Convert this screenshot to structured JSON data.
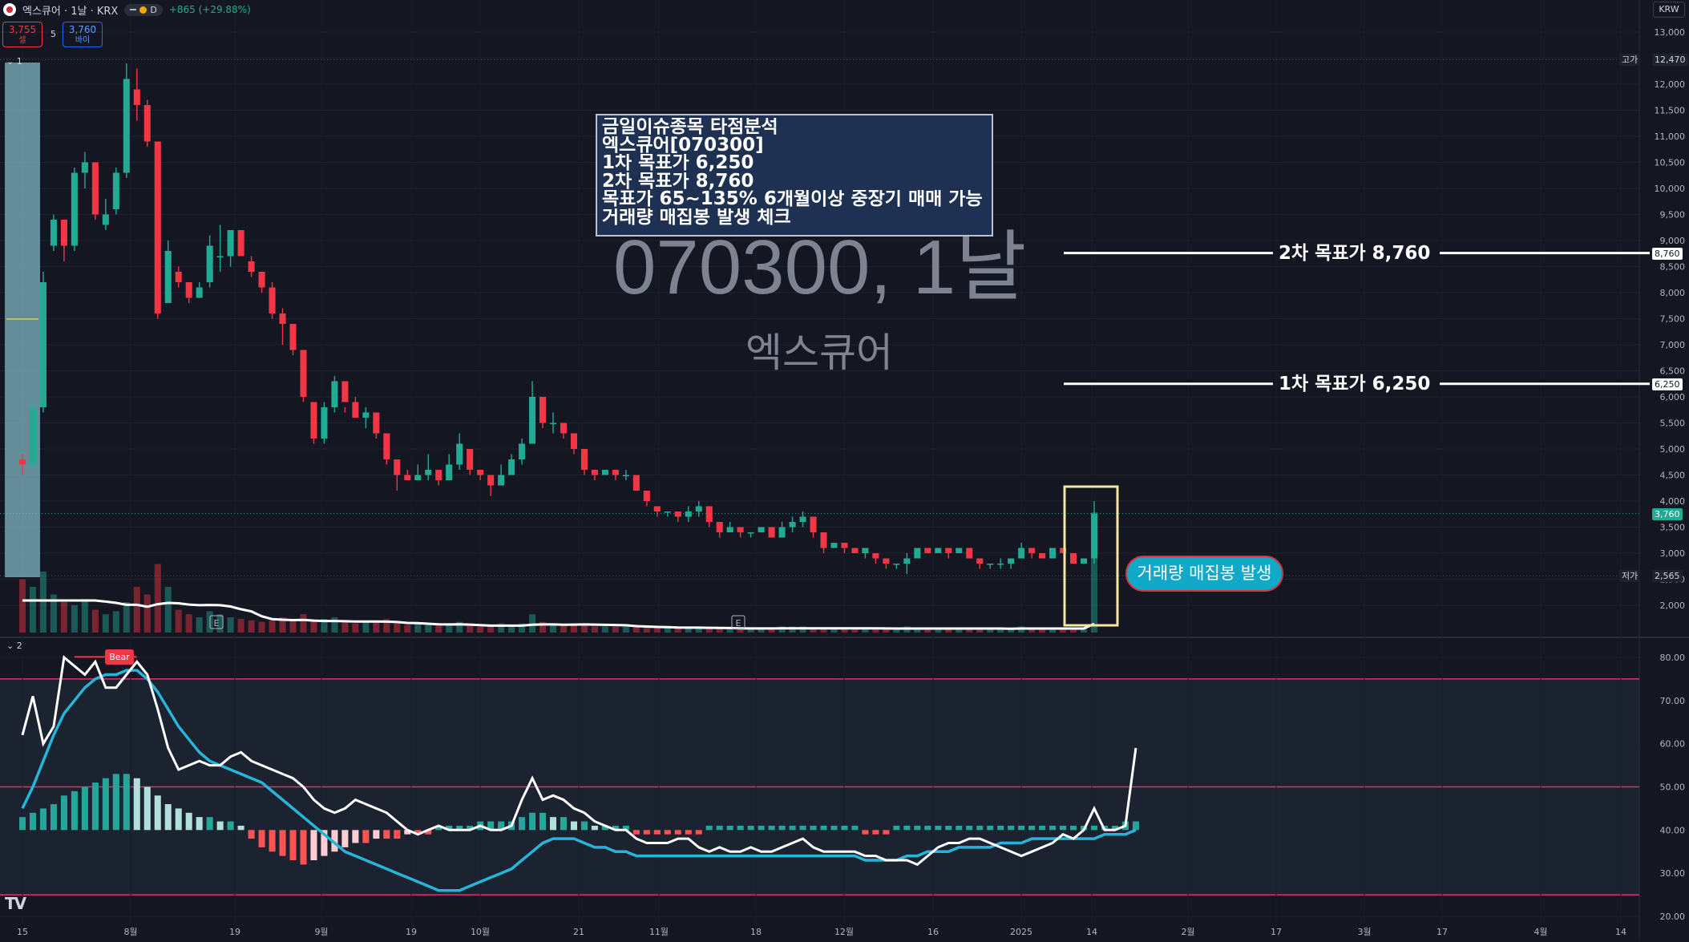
{
  "header": {
    "symbol_title": "엑스큐어 · 1날 · KRX",
    "interval_badge": "D",
    "change_text": "+865 (+29.88%)",
    "sell_price": "3,755",
    "sell_label": "셀",
    "spread": "5",
    "buy_price": "3,760",
    "buy_label": "바이",
    "currency": "KRW",
    "pane1_label": "1",
    "pane2_label": "2"
  },
  "watermark": {
    "title": "070300, 1날",
    "subtitle": "엑스큐어"
  },
  "note_lines": [
    "금일이슈종목 타점분석",
    "엑스큐어[070300]",
    "1차 목표가 6,250",
    "2차 목표가 8,760",
    "목표가 65~135% 6개월이상 중장기 매매 가능",
    "거래량 매집봉 발생 체크"
  ],
  "targets": {
    "t2": {
      "label": "2차 목표가 8,760",
      "price": 8760,
      "tag": "8,760"
    },
    "t1": {
      "label": "1차 목표가 6,250",
      "price": 6250,
      "tag": "6,250"
    }
  },
  "callout": "거래량 매집봉 발생",
  "price_tags": {
    "high_label": "고가",
    "high_value": "12,470",
    "high_price": 12470,
    "last_value": "3,760",
    "last_price": 3760,
    "low_label": "저가",
    "low_value": "2,565",
    "low_price": 2565
  },
  "indicator_label": "Bear",
  "earnings_marker": "E",
  "colors": {
    "up": "#22ab94",
    "down": "#f23645",
    "background": "#141722",
    "osc_line": "#ffffff",
    "signal_line": "#26b5d8",
    "band": "#e0306a"
  },
  "chart_data": {
    "type": "candlestick",
    "price_axis": {
      "min": 1800,
      "max": 13000,
      "ticks": [
        2000,
        2500,
        3000,
        3500,
        4000,
        4500,
        5000,
        5500,
        6000,
        6500,
        7000,
        7500,
        8000,
        8500,
        9000,
        9500,
        10000,
        10500,
        11000,
        11500,
        12000,
        12500,
        13000
      ]
    },
    "osc_axis": {
      "min": 20,
      "max": 82,
      "ticks": [
        20,
        30,
        40,
        50,
        60,
        70,
        80
      ],
      "bands": [
        75,
        50,
        25
      ]
    },
    "x_ticks": [
      "15",
      "8월",
      "19",
      "9월",
      "19",
      "10월",
      "21",
      "11월",
      "18",
      "12월",
      "16",
      "2025",
      "14",
      "2월",
      "17",
      "3월",
      "17",
      "4월",
      "14"
    ],
    "earnings_at": [
      50,
      164
    ],
    "candles": [
      [
        4800,
        4900,
        4500,
        4700
      ],
      [
        4700,
        5900,
        4600,
        5800
      ],
      [
        5800,
        8400,
        5700,
        8200
      ],
      [
        8900,
        9500,
        8800,
        9400
      ],
      [
        9400,
        9300,
        8600,
        8900
      ],
      [
        8900,
        10400,
        8800,
        10300
      ],
      [
        10300,
        10700,
        10000,
        10500
      ],
      [
        10500,
        10100,
        9400,
        9500
      ],
      [
        9300,
        9800,
        9200,
        9500
      ],
      [
        9600,
        10400,
        9500,
        10300
      ],
      [
        10300,
        12400,
        10200,
        12100
      ],
      [
        11900,
        12300,
        11300,
        11600
      ],
      [
        11600,
        11700,
        10800,
        10900
      ],
      [
        10900,
        10700,
        7500,
        7600
      ],
      [
        7800,
        9000,
        7800,
        8800
      ],
      [
        8400,
        8500,
        8100,
        8200
      ],
      [
        8200,
        8000,
        7800,
        7900
      ],
      [
        7900,
        8200,
        7900,
        8100
      ],
      [
        8200,
        9100,
        8100,
        8900
      ],
      [
        8700,
        9300,
        8400,
        8700
      ],
      [
        8700,
        9200,
        8500,
        9200
      ],
      [
        9200,
        8800,
        8700,
        8700
      ],
      [
        8600,
        8700,
        8300,
        8400
      ],
      [
        8400,
        8200,
        8000,
        8100
      ],
      [
        8100,
        8200,
        7500,
        7600
      ],
      [
        7600,
        7700,
        7000,
        7400
      ],
      [
        7400,
        7300,
        6800,
        6900
      ],
      [
        6900,
        6700,
        5900,
        6000
      ],
      [
        5900,
        5400,
        5100,
        5200
      ],
      [
        5200,
        5900,
        5100,
        5800
      ],
      [
        5800,
        6400,
        5700,
        6300
      ],
      [
        6300,
        5800,
        5700,
        5900
      ],
      [
        5900,
        6000,
        5600,
        5600
      ],
      [
        5600,
        5800,
        5400,
        5700
      ],
      [
        5700,
        5600,
        5200,
        5300
      ],
      [
        5300,
        5200,
        4700,
        4800
      ],
      [
        4800,
        4600,
        4200,
        4500
      ],
      [
        4500,
        4600,
        4400,
        4400
      ],
      [
        4400,
        4700,
        4400,
        4500
      ],
      [
        4500,
        4900,
        4400,
        4600
      ],
      [
        4600,
        4500,
        4300,
        4400
      ],
      [
        4400,
        4900,
        4400,
        4700
      ],
      [
        4700,
        5300,
        4600,
        5100
      ],
      [
        5000,
        4700,
        4500,
        4600
      ],
      [
        4600,
        4600,
        4400,
        4500
      ],
      [
        4500,
        4400,
        4100,
        4300
      ],
      [
        4300,
        4700,
        4300,
        4500
      ],
      [
        4500,
        4900,
        4500,
        4800
      ],
      [
        4800,
        5200,
        4700,
        5100
      ],
      [
        5100,
        6300,
        5100,
        6000
      ],
      [
        6000,
        5700,
        5400,
        5500
      ],
      [
        5500,
        5700,
        5300,
        5500
      ],
      [
        5500,
        5400,
        5200,
        5300
      ],
      [
        5300,
        5200,
        4900,
        5000
      ],
      [
        5000,
        4700,
        4500,
        4600
      ],
      [
        4600,
        4600,
        4400,
        4500
      ],
      [
        4500,
        4600,
        4500,
        4600
      ],
      [
        4600,
        4500,
        4400,
        4500
      ],
      [
        4500,
        4600,
        4400,
        4500
      ],
      [
        4500,
        4300,
        4200,
        4200
      ],
      [
        4200,
        4000,
        3900,
        4000
      ],
      [
        3900,
        3900,
        3700,
        3800
      ],
      [
        3800,
        3800,
        3700,
        3800
      ],
      [
        3800,
        3700,
        3600,
        3700
      ],
      [
        3700,
        3900,
        3600,
        3800
      ],
      [
        3800,
        4000,
        3700,
        3900
      ],
      [
        3900,
        3700,
        3500,
        3600
      ],
      [
        3600,
        3500,
        3300,
        3400
      ],
      [
        3400,
        3600,
        3400,
        3500
      ],
      [
        3500,
        3500,
        3300,
        3400
      ],
      [
        3400,
        3400,
        3300,
        3400
      ],
      [
        3400,
        3500,
        3400,
        3500
      ],
      [
        3500,
        3400,
        3300,
        3300
      ],
      [
        3300,
        3600,
        3300,
        3500
      ],
      [
        3500,
        3700,
        3400,
        3600
      ],
      [
        3600,
        3800,
        3500,
        3700
      ],
      [
        3700,
        3500,
        3300,
        3400
      ],
      [
        3400,
        3200,
        3000,
        3100
      ],
      [
        3100,
        3200,
        3100,
        3200
      ],
      [
        3200,
        3100,
        3000,
        3100
      ],
      [
        3100,
        3100,
        3000,
        3000
      ],
      [
        3000,
        3100,
        2900,
        3100
      ],
      [
        3000,
        2900,
        2800,
        2900
      ],
      [
        2900,
        2800,
        2700,
        2800
      ],
      [
        2800,
        2800,
        2700,
        2800
      ],
      [
        2800,
        3000,
        2600,
        2900
      ],
      [
        2900,
        3100,
        2900,
        3100
      ],
      [
        3100,
        3000,
        3000,
        3000
      ],
      [
        3000,
        3100,
        3000,
        3100
      ],
      [
        3100,
        3100,
        2900,
        3000
      ],
      [
        3000,
        3100,
        3000,
        3100
      ],
      [
        3100,
        3000,
        2900,
        2900
      ],
      [
        2900,
        2800,
        2700,
        2800
      ],
      [
        2800,
        2800,
        2700,
        2800
      ],
      [
        2800,
        2900,
        2700,
        2800
      ],
      [
        2800,
        2900,
        2700,
        2900
      ],
      [
        2900,
        3200,
        2900,
        3100
      ],
      [
        3100,
        3000,
        2900,
        3000
      ],
      [
        3000,
        3000,
        2900,
        2900
      ],
      [
        2900,
        3100,
        2900,
        3100
      ],
      [
        3100,
        3100,
        3000,
        3000
      ],
      [
        3000,
        2900,
        2800,
        2800
      ],
      [
        2800,
        2900,
        2800,
        2900
      ],
      [
        2900,
        4000,
        2800,
        3760
      ]
    ],
    "volume": [
      35,
      30,
      40,
      25,
      20,
      18,
      22,
      15,
      12,
      14,
      20,
      30,
      25,
      45,
      30,
      15,
      12,
      10,
      14,
      12,
      10,
      9,
      8,
      7,
      8,
      10,
      9,
      12,
      8,
      9,
      10,
      7,
      6,
      7,
      8,
      9,
      6,
      5,
      6,
      5,
      5,
      6,
      7,
      5,
      4,
      5,
      6,
      5,
      6,
      12,
      7,
      6,
      5,
      6,
      5,
      4,
      4,
      4,
      4,
      5,
      4,
      3,
      3,
      3,
      4,
      4,
      3,
      3,
      3,
      3,
      3,
      3,
      3,
      4,
      4,
      4,
      3,
      3,
      3,
      3,
      3,
      3,
      3,
      3,
      3,
      4,
      3,
      3,
      3,
      3,
      3,
      3,
      3,
      3,
      3,
      3,
      4,
      3,
      3,
      3,
      3,
      3,
      3,
      40
    ],
    "oscillator": [
      62,
      71,
      60,
      64,
      80,
      78,
      76,
      79,
      73,
      73,
      76,
      79,
      76,
      68,
      59,
      54,
      55,
      56,
      55,
      55,
      57,
      58,
      56,
      55,
      54,
      53,
      52,
      50,
      47,
      45,
      44,
      45,
      47,
      46,
      45,
      44,
      42,
      40,
      39,
      40,
      41,
      40,
      40,
      40,
      41,
      40,
      40,
      41,
      47,
      52,
      47,
      48,
      47,
      45,
      44,
      42,
      41,
      40,
      40,
      38,
      37,
      37,
      37,
      38,
      38,
      36,
      35,
      36,
      35,
      35,
      36,
      35,
      35,
      36,
      37,
      38,
      36,
      35,
      35,
      35,
      35,
      34,
      34,
      33,
      33,
      33,
      32,
      34,
      36,
      37,
      37,
      38,
      38,
      37,
      36,
      35,
      34,
      35,
      36,
      37,
      39,
      38,
      40,
      45,
      40,
      40,
      41,
      59
    ],
    "signal": [
      45,
      50,
      56,
      62,
      67,
      70,
      73,
      75,
      76,
      76,
      77,
      77,
      75,
      72,
      68,
      64,
      61,
      58,
      56,
      55,
      54,
      53,
      52,
      51,
      49,
      47,
      45,
      43,
      41,
      39,
      37,
      35,
      34,
      33,
      32,
      31,
      30,
      29,
      28,
      27,
      26,
      26,
      26,
      27,
      28,
      29,
      30,
      31,
      33,
      35,
      37,
      38,
      38,
      38,
      37,
      36,
      36,
      35,
      35,
      34,
      34,
      34,
      34,
      34,
      34,
      34,
      34,
      34,
      34,
      34,
      34,
      34,
      34,
      34,
      34,
      34,
      34,
      34,
      34,
      34,
      34,
      33,
      33,
      33,
      33,
      34,
      34,
      35,
      35,
      35,
      36,
      36,
      36,
      36,
      37,
      37,
      37,
      38,
      38,
      38,
      38,
      38,
      38,
      38,
      39,
      39,
      39,
      40
    ],
    "histogram": [
      3,
      4,
      5,
      6,
      8,
      9,
      10,
      11,
      12,
      13,
      13,
      12,
      10,
      8,
      6,
      5,
      4,
      3,
      3,
      2,
      2,
      1,
      -2,
      -4,
      -5,
      -6,
      -7,
      -8,
      -7,
      -6,
      -5,
      -4,
      -3,
      -3,
      -2,
      -2,
      -2,
      -1,
      -1,
      -1,
      1,
      1,
      1,
      1,
      2,
      2,
      2,
      2,
      3,
      4,
      4,
      3,
      3,
      2,
      2,
      1,
      1,
      1,
      1,
      -1,
      -1,
      -1,
      -1,
      -1,
      -1,
      -1,
      1,
      1,
      1,
      1,
      1,
      1,
      1,
      1,
      1,
      1,
      1,
      1,
      1,
      1,
      1,
      -1,
      -1,
      -1,
      1,
      1,
      1,
      1,
      1,
      1,
      1,
      1,
      1,
      1,
      1,
      1,
      1,
      1,
      1,
      1,
      1,
      1,
      1,
      1,
      1,
      1,
      2,
      2
    ]
  }
}
